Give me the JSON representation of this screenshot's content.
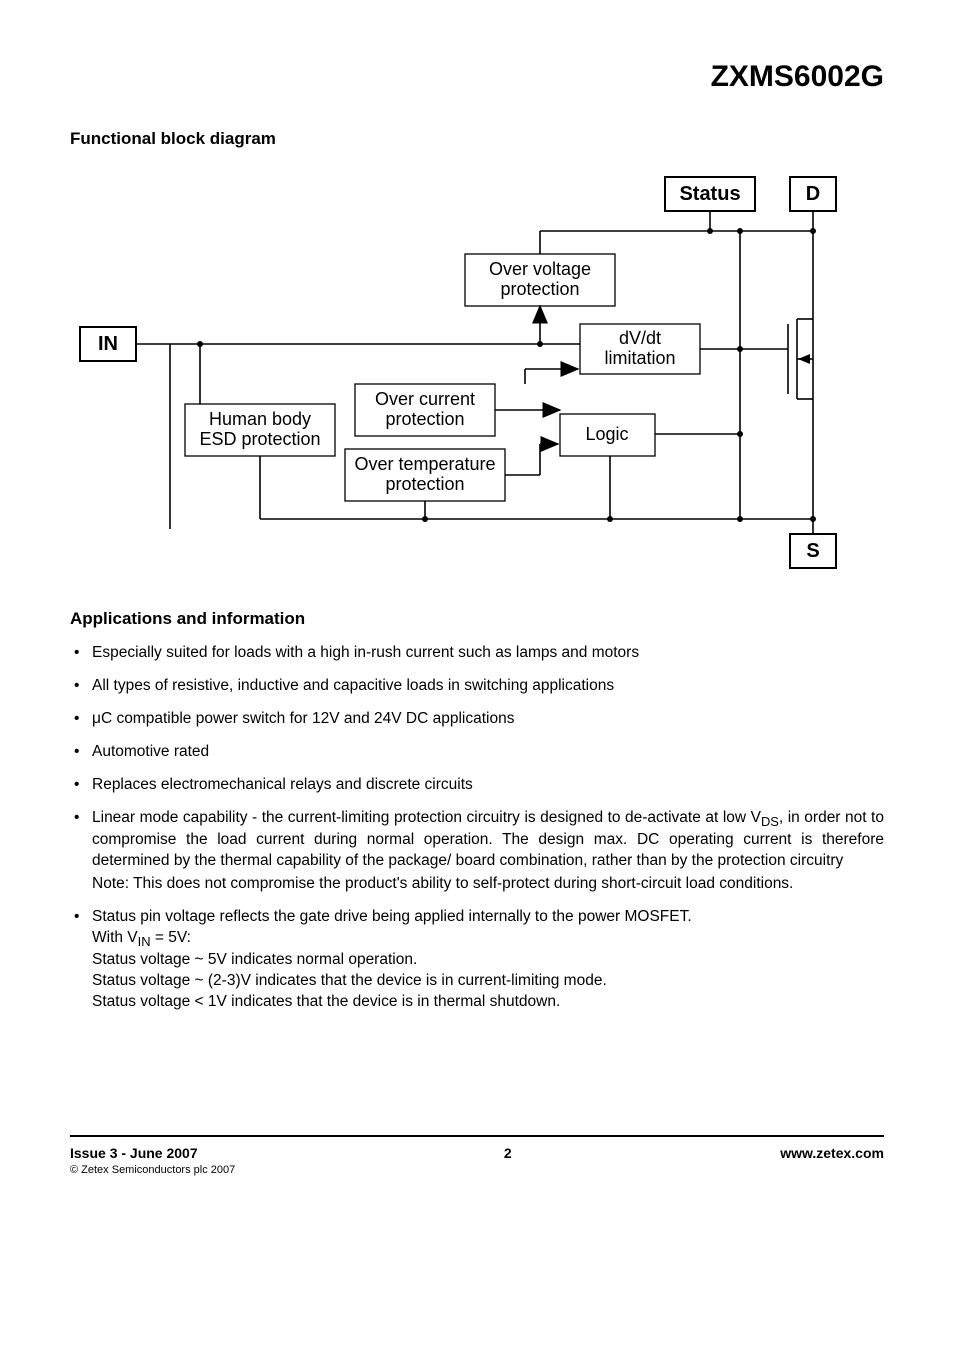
{
  "part_number": "ZXMS6002G",
  "section_block_diagram": "Functional block diagram",
  "diagram": {
    "terminals": {
      "in": "IN",
      "status": "Status",
      "d": "D",
      "s": "S"
    },
    "blocks": {
      "esd_l1": "Human body",
      "esd_l2": "ESD protection",
      "ovp_l1": "Over voltage",
      "ovp_l2": "protection",
      "ocp_l1": "Over current",
      "ocp_l2": "protection",
      "otp_l1": "Over temperature",
      "otp_l2": "protection",
      "dvdt_l1": "dV/dt",
      "dvdt_l2": "limitation",
      "logic": "Logic"
    }
  },
  "section_applications": "Applications and information",
  "bullets": {
    "b1": "Especially suited for loads with a high in-rush current such as lamps and motors",
    "b2": "All types of resistive, inductive and capacitive loads in switching applications",
    "b3_pre": "",
    "b3_post": "C compatible power switch for 12V and 24V DC applications",
    "b4": "Automotive rated",
    "b5": "Replaces electromechanical relays and discrete circuits",
    "b6_l1a": "Linear mode capability - the current-limiting protection circuitry is designed to de-activate at low V",
    "b6_l1b": ", in order not to compromise the load current during normal operation. The design max. DC operating current is therefore determined by the thermal capability of the package/ board combination, rather than by the protection circuitry",
    "b6_note": "Note: This does not compromise the product's ability to self-protect during short-circuit load conditions.",
    "b7_l1": "Status pin voltage reflects the gate drive being applied internally to the power MOSFET.",
    "b7_l2a": "With V",
    "b7_l2b": " = 5V:",
    "b7_l3": "Status voltage ~ 5V indicates normal operation.",
    "b7_l4": "Status voltage ~ (2-3)V indicates that the device is in current-limiting mode.",
    "b7_l5": "Status voltage < 1V indicates that the device is in thermal shutdown."
  },
  "subscripts": {
    "ds": "DS",
    "in": "IN"
  },
  "mu": "μ",
  "footer": {
    "issue": "Issue 3 - June 2007",
    "copyright": "© Zetex Semiconductors plc 2007",
    "page": "2",
    "url": "www.zetex.com"
  }
}
